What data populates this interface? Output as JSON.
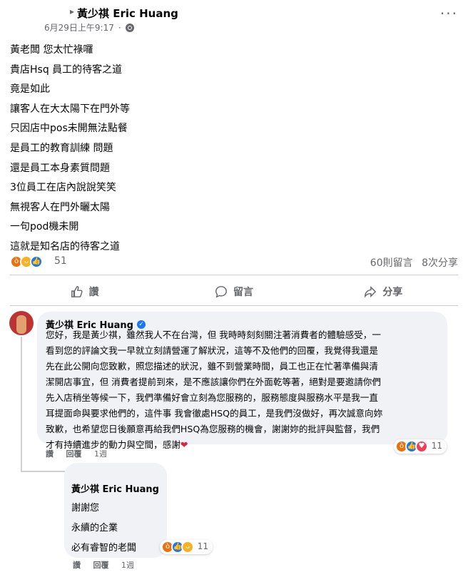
{
  "post": {
    "author": "黃少祺 Eric Huang",
    "timestamp": "6月29日上午9:17",
    "more_label": "···",
    "lines": [
      "黃老闆 您太忙祿囉",
      "貴店Hsq 員工的待客之道",
      "竟是如此",
      "讓客人在大太陽下在門外等",
      "只因店中pos未開無法點餐",
      "是員工的教育訓練 問題",
      "還是員工本身素質問題",
      "3位員工在店內說說笑笑",
      "無視客人在門外曬太陽",
      "一句pod機未開",
      "這就是知名店的待客之道"
    ],
    "reaction_count": "51",
    "comments_count": "60則留言",
    "shares_count": "8次分享"
  },
  "actions": {
    "like": "讚",
    "comment": "留言",
    "share": "分享"
  },
  "comment1": {
    "author": "黃少祺 Eric Huang",
    "lines": [
      "您好，我是黃少祺，雖然我人不在台灣，但 我時時刻刻關注著消費者的體驗感受，一",
      "看到您的評論文我一早就立刻請營運了解狀況，這等不及他們的回覆，我覺得我還是",
      "先在此公開向您致歉，照您描述的狀況，雖不到營業時間，員工也正在忙著準備與清",
      "潔開店事宜，但 消費者提前到來，是不應該讓你們在外面乾等著，絕對是要邀請你們",
      "先入店稍坐等候一下，我們準備好會立刻為您服務的，服務態度與服務水平是我一直",
      "耳提面命與要求他們的，這件事 我會徹處HSQ的員工，是我們沒做好，再次誠意向妳",
      "致歉，也希望您日後願意再給我們HSQ為您服務的機會，謝謝妳的批評與監督，我們",
      "才有持續進步的動力與空間，感謝"
    ],
    "heart": "❤",
    "like": "讚",
    "reply": "回覆",
    "time": "1週",
    "reaction_count": "11"
  },
  "comment2": {
    "author": "黃少祺 Eric Huang",
    "lines": [
      "謝謝您",
      "永續的企業",
      "必有睿智的老闆"
    ],
    "like": "讚",
    "reply": "回覆",
    "time": "1週",
    "reaction_count": "11"
  },
  "colors": {
    "like_blue": "#1877f2",
    "angry_orange": "#e9710f",
    "haha_yellow": "#f7b125",
    "love_red": "#f33e58",
    "bubble_gray": "#f0f2f5"
  },
  "icons": [
    "globe-icon",
    "more-icon",
    "like-icon",
    "comment-icon",
    "share-icon",
    "verified-icon"
  ]
}
